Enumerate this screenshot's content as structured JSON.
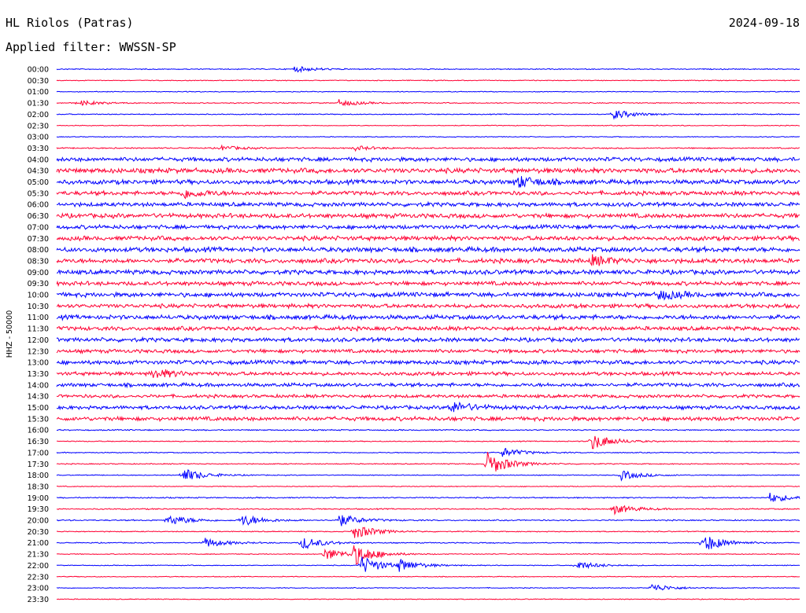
{
  "header": {
    "station": "HL Riolos (Patras)",
    "date": "2024-09-18",
    "filter": "Applied filter: WWSSN-SP"
  },
  "chart_data": {
    "type": "line",
    "title": "HL Riolos (Patras)",
    "ylabel": "HHZ - 50000",
    "xlabel": "",
    "colors": [
      "#0000ff",
      "#ff0033"
    ],
    "row_labels": [
      "00:00",
      "00:30",
      "01:00",
      "01:30",
      "02:00",
      "02:30",
      "03:00",
      "03:30",
      "04:00",
      "04:30",
      "05:00",
      "05:30",
      "06:00",
      "06:30",
      "07:00",
      "07:30",
      "08:00",
      "08:30",
      "09:00",
      "09:30",
      "10:00",
      "10:30",
      "11:00",
      "11:30",
      "12:00",
      "12:30",
      "13:00",
      "13:30",
      "14:00",
      "14:30",
      "15:00",
      "15:30",
      "16:00",
      "16:30",
      "17:00",
      "17:30",
      "18:00",
      "18:30",
      "19:00",
      "19:30",
      "20:00",
      "20:30",
      "21:00",
      "21:30",
      "22:00",
      "22:30",
      "23:00",
      "23:30"
    ],
    "noise_level": [
      0.12,
      0.1,
      0.1,
      0.12,
      0.12,
      0.1,
      0.1,
      0.15,
      0.5,
      0.6,
      0.55,
      0.5,
      0.5,
      0.55,
      0.5,
      0.55,
      0.6,
      0.55,
      0.55,
      0.5,
      0.55,
      0.5,
      0.55,
      0.5,
      0.5,
      0.45,
      0.5,
      0.45,
      0.45,
      0.4,
      0.45,
      0.5,
      0.15,
      0.12,
      0.12,
      0.12,
      0.1,
      0.1,
      0.15,
      0.15,
      0.15,
      0.12,
      0.12,
      0.1,
      0.1,
      0.1,
      0.1,
      0.1
    ],
    "events": [
      {
        "row": 0,
        "t": 0.32,
        "amp": 0.6
      },
      {
        "row": 3,
        "t": 0.03,
        "amp": 0.55
      },
      {
        "row": 3,
        "t": 0.38,
        "amp": 0.7
      },
      {
        "row": 4,
        "t": 0.75,
        "amp": 1.0
      },
      {
        "row": 7,
        "t": 0.22,
        "amp": 0.5
      },
      {
        "row": 7,
        "t": 0.4,
        "amp": 0.5
      },
      {
        "row": 10,
        "t": 0.62,
        "amp": 1.2
      },
      {
        "row": 11,
        "t": 0.17,
        "amp": 1.0
      },
      {
        "row": 17,
        "t": 0.72,
        "amp": 1.0
      },
      {
        "row": 20,
        "t": 0.81,
        "amp": 1.0
      },
      {
        "row": 27,
        "t": 0.13,
        "amp": 1.0
      },
      {
        "row": 30,
        "t": 0.53,
        "amp": 1.2
      },
      {
        "row": 33,
        "t": 0.72,
        "amp": 1.8
      },
      {
        "row": 35,
        "t": 0.58,
        "amp": 2.5
      },
      {
        "row": 34,
        "t": 0.6,
        "amp": 1.0
      },
      {
        "row": 36,
        "t": 0.17,
        "amp": 1.5
      },
      {
        "row": 36,
        "t": 0.76,
        "amp": 1.0
      },
      {
        "row": 38,
        "t": 0.96,
        "amp": 1.0
      },
      {
        "row": 39,
        "t": 0.75,
        "amp": 1.0
      },
      {
        "row": 40,
        "t": 0.15,
        "amp": 1.2
      },
      {
        "row": 40,
        "t": 0.25,
        "amp": 1.2
      },
      {
        "row": 40,
        "t": 0.38,
        "amp": 1.3
      },
      {
        "row": 41,
        "t": 0.4,
        "amp": 1.6
      },
      {
        "row": 42,
        "t": 0.2,
        "amp": 1.0
      },
      {
        "row": 42,
        "t": 0.33,
        "amp": 1.4
      },
      {
        "row": 42,
        "t": 0.87,
        "amp": 2.0
      },
      {
        "row": 43,
        "t": 0.36,
        "amp": 1.4
      },
      {
        "row": 43,
        "t": 0.4,
        "amp": 2.2
      },
      {
        "row": 44,
        "t": 0.41,
        "amp": 2.0
      },
      {
        "row": 44,
        "t": 0.46,
        "amp": 1.2
      },
      {
        "row": 44,
        "t": 0.7,
        "amp": 0.9
      },
      {
        "row": 46,
        "t": 0.8,
        "amp": 0.9
      }
    ]
  }
}
